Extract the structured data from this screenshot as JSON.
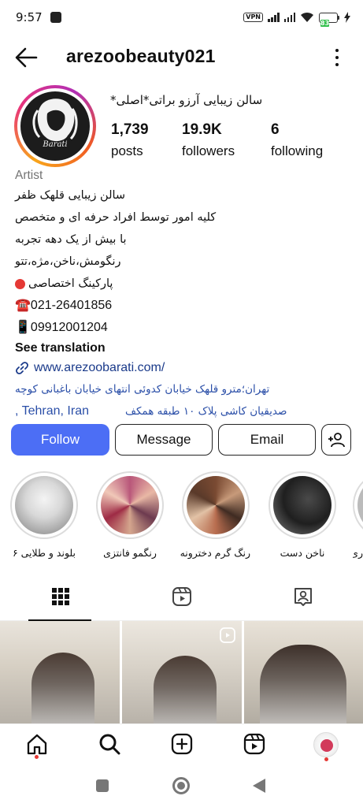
{
  "status": {
    "time": "9:57",
    "vpn": "VPN",
    "battery": "83"
  },
  "header": {
    "username": "arezoobeauty021"
  },
  "profile": {
    "display_name": "سالن زیبایی آرزو براتی*اصلی*",
    "avatar_text": "Barati",
    "stats": [
      {
        "value": "1,739",
        "label": "posts"
      },
      {
        "value": "19.9K",
        "label": "followers"
      },
      {
        "value": "6",
        "label": "following"
      }
    ]
  },
  "bio": {
    "category": "Artist",
    "lines": [
      "سالن زیبایی قلهک ظفر",
      "کلیه امور توسط افراد حرفه ای و متخصص",
      "با بیش از یک دهه تجربه",
      "رنگومش،ناخن،مژه،تتو",
      "پارکینگ اختصاصی",
      "☎️021-26401856",
      "📱09912001204"
    ],
    "see_translation": "See translation",
    "link": "www.arezoobarati.com/",
    "address_line1": "تهران؛مترو قلهک خیابان کدوئی انتهای خیابان باغبانی کوچه",
    "address_city": ", Tehran, Iran",
    "address_line2": "صدیقیان کاشی پلاک ۱۰ طبقه همکف"
  },
  "buttons": {
    "follow": "Follow",
    "message": "Message",
    "email": "Email"
  },
  "highlights": [
    {
      "label": "بلوند و طلایی ۶"
    },
    {
      "label": "رنگمو فانتزی"
    },
    {
      "label": "رنگ گرم دخترونه"
    },
    {
      "label": "ناخن دست"
    },
    {
      "label": "ری"
    }
  ],
  "tabs": [
    "grid-icon",
    "reels-icon",
    "tagged-icon"
  ],
  "bottom_nav": [
    "home-icon",
    "search-icon",
    "create-icon",
    "reels-icon",
    "profile-avatar"
  ],
  "colors": {
    "follow_button": "#4c6ef5",
    "link": "#2b4fa8",
    "notification_dot": "#e53935"
  }
}
